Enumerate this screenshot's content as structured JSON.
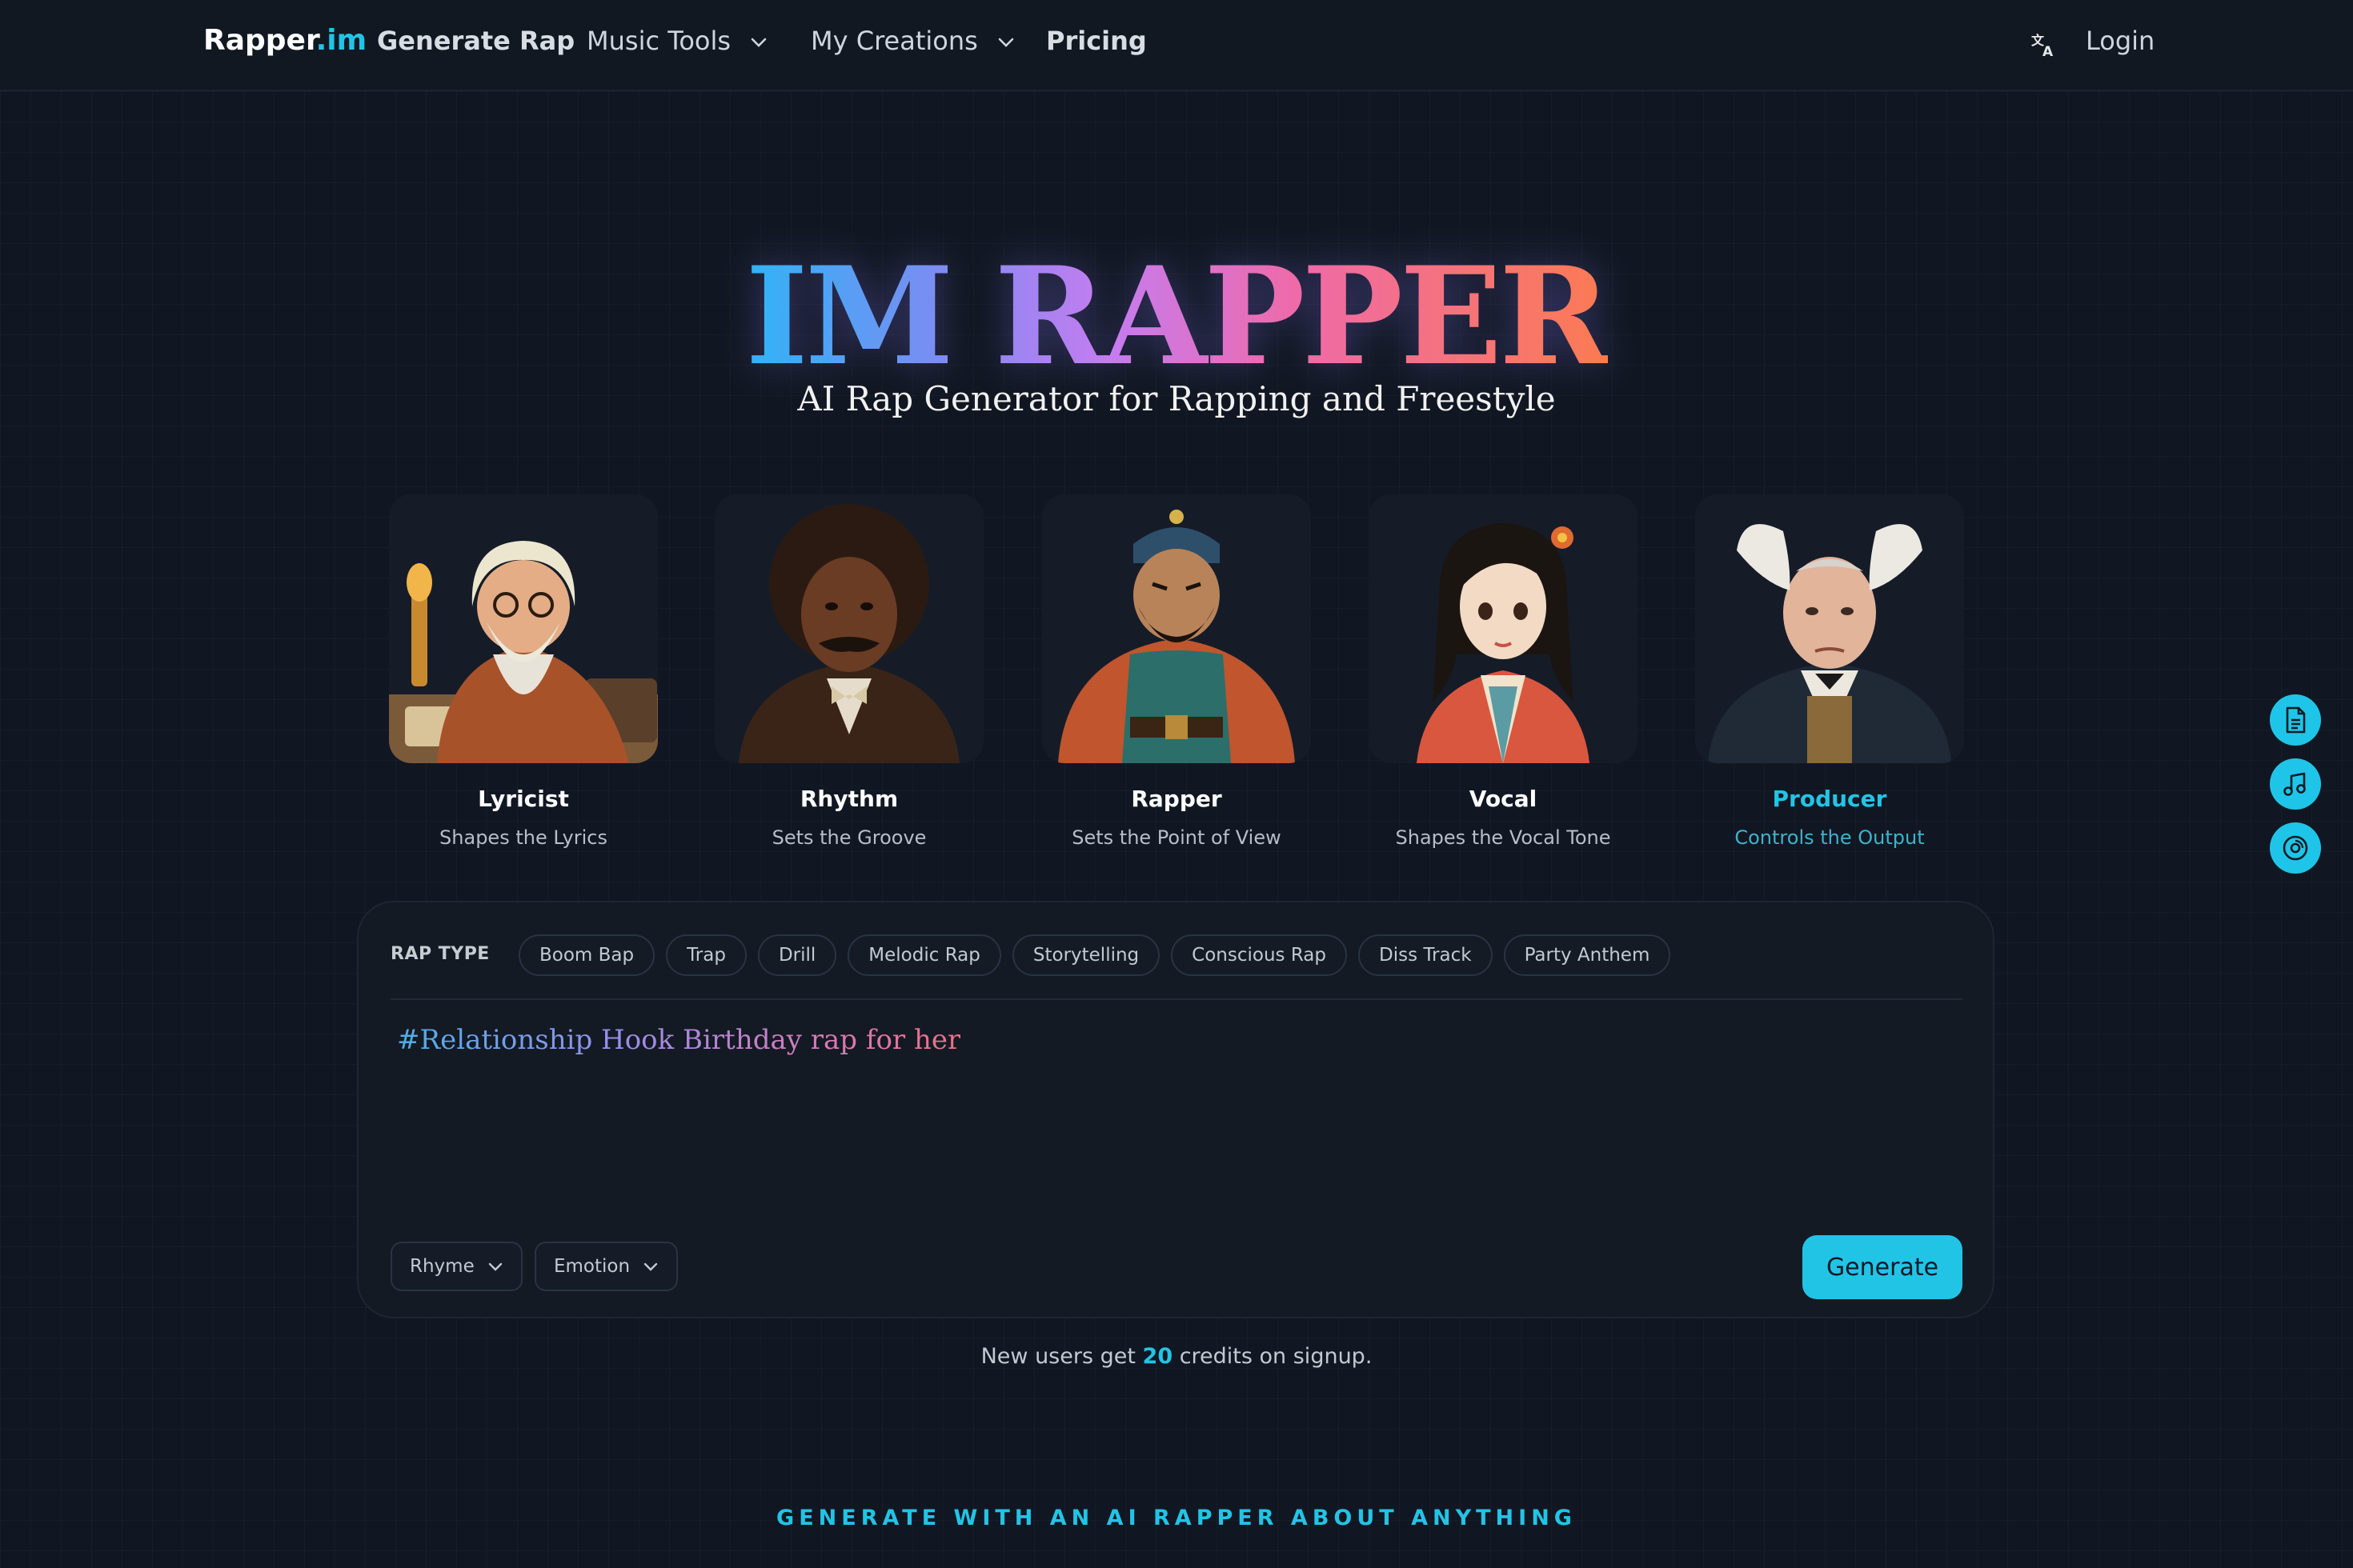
{
  "nav": {
    "brand_main": "Rapper",
    "brand_accent": ".im",
    "items": [
      {
        "label": "Generate Rap"
      },
      {
        "label": "Music Tools"
      },
      {
        "label": "My Creations"
      },
      {
        "label": "Pricing"
      }
    ],
    "language_icon": "translate-icon",
    "login": "Login"
  },
  "hero": {
    "title": "IM RAPPER",
    "subtitle": "AI Rap Generator for Rapping and Freestyle"
  },
  "roles": [
    {
      "name": "Lyricist",
      "desc": "Shapes the Lyrics",
      "active": false
    },
    {
      "name": "Rhythm",
      "desc": "Sets the Groove",
      "active": false
    },
    {
      "name": "Rapper",
      "desc": "Sets the Point of View",
      "active": false
    },
    {
      "name": "Vocal",
      "desc": "Shapes the Vocal Tone",
      "active": false
    },
    {
      "name": "Producer",
      "desc": "Controls the Output",
      "active": true
    }
  ],
  "side_buttons": [
    {
      "icon": "document-icon"
    },
    {
      "icon": "music-note-icon"
    },
    {
      "icon": "disc-icon"
    }
  ],
  "generator": {
    "rap_type_label": "RAP TYPE",
    "rap_types": [
      "Boom Bap",
      "Trap",
      "Drill",
      "Melodic Rap",
      "Storytelling",
      "Conscious Rap",
      "Diss Track",
      "Party Anthem"
    ],
    "prompt": "#Relationship Hook Birthday rap for her",
    "rhyme_label": "Rhyme",
    "emotion_label": "Emotion",
    "generate_label": "Generate"
  },
  "credits": {
    "before": "New users get ",
    "amount": "20",
    "after": " credits on signup."
  },
  "section": {
    "eyebrow": "GENERATE WITH AN AI RAPPER ABOUT ANYTHING"
  },
  "colors": {
    "accent": "#22c4e6",
    "background": "#111722",
    "panel": "#131a24"
  }
}
